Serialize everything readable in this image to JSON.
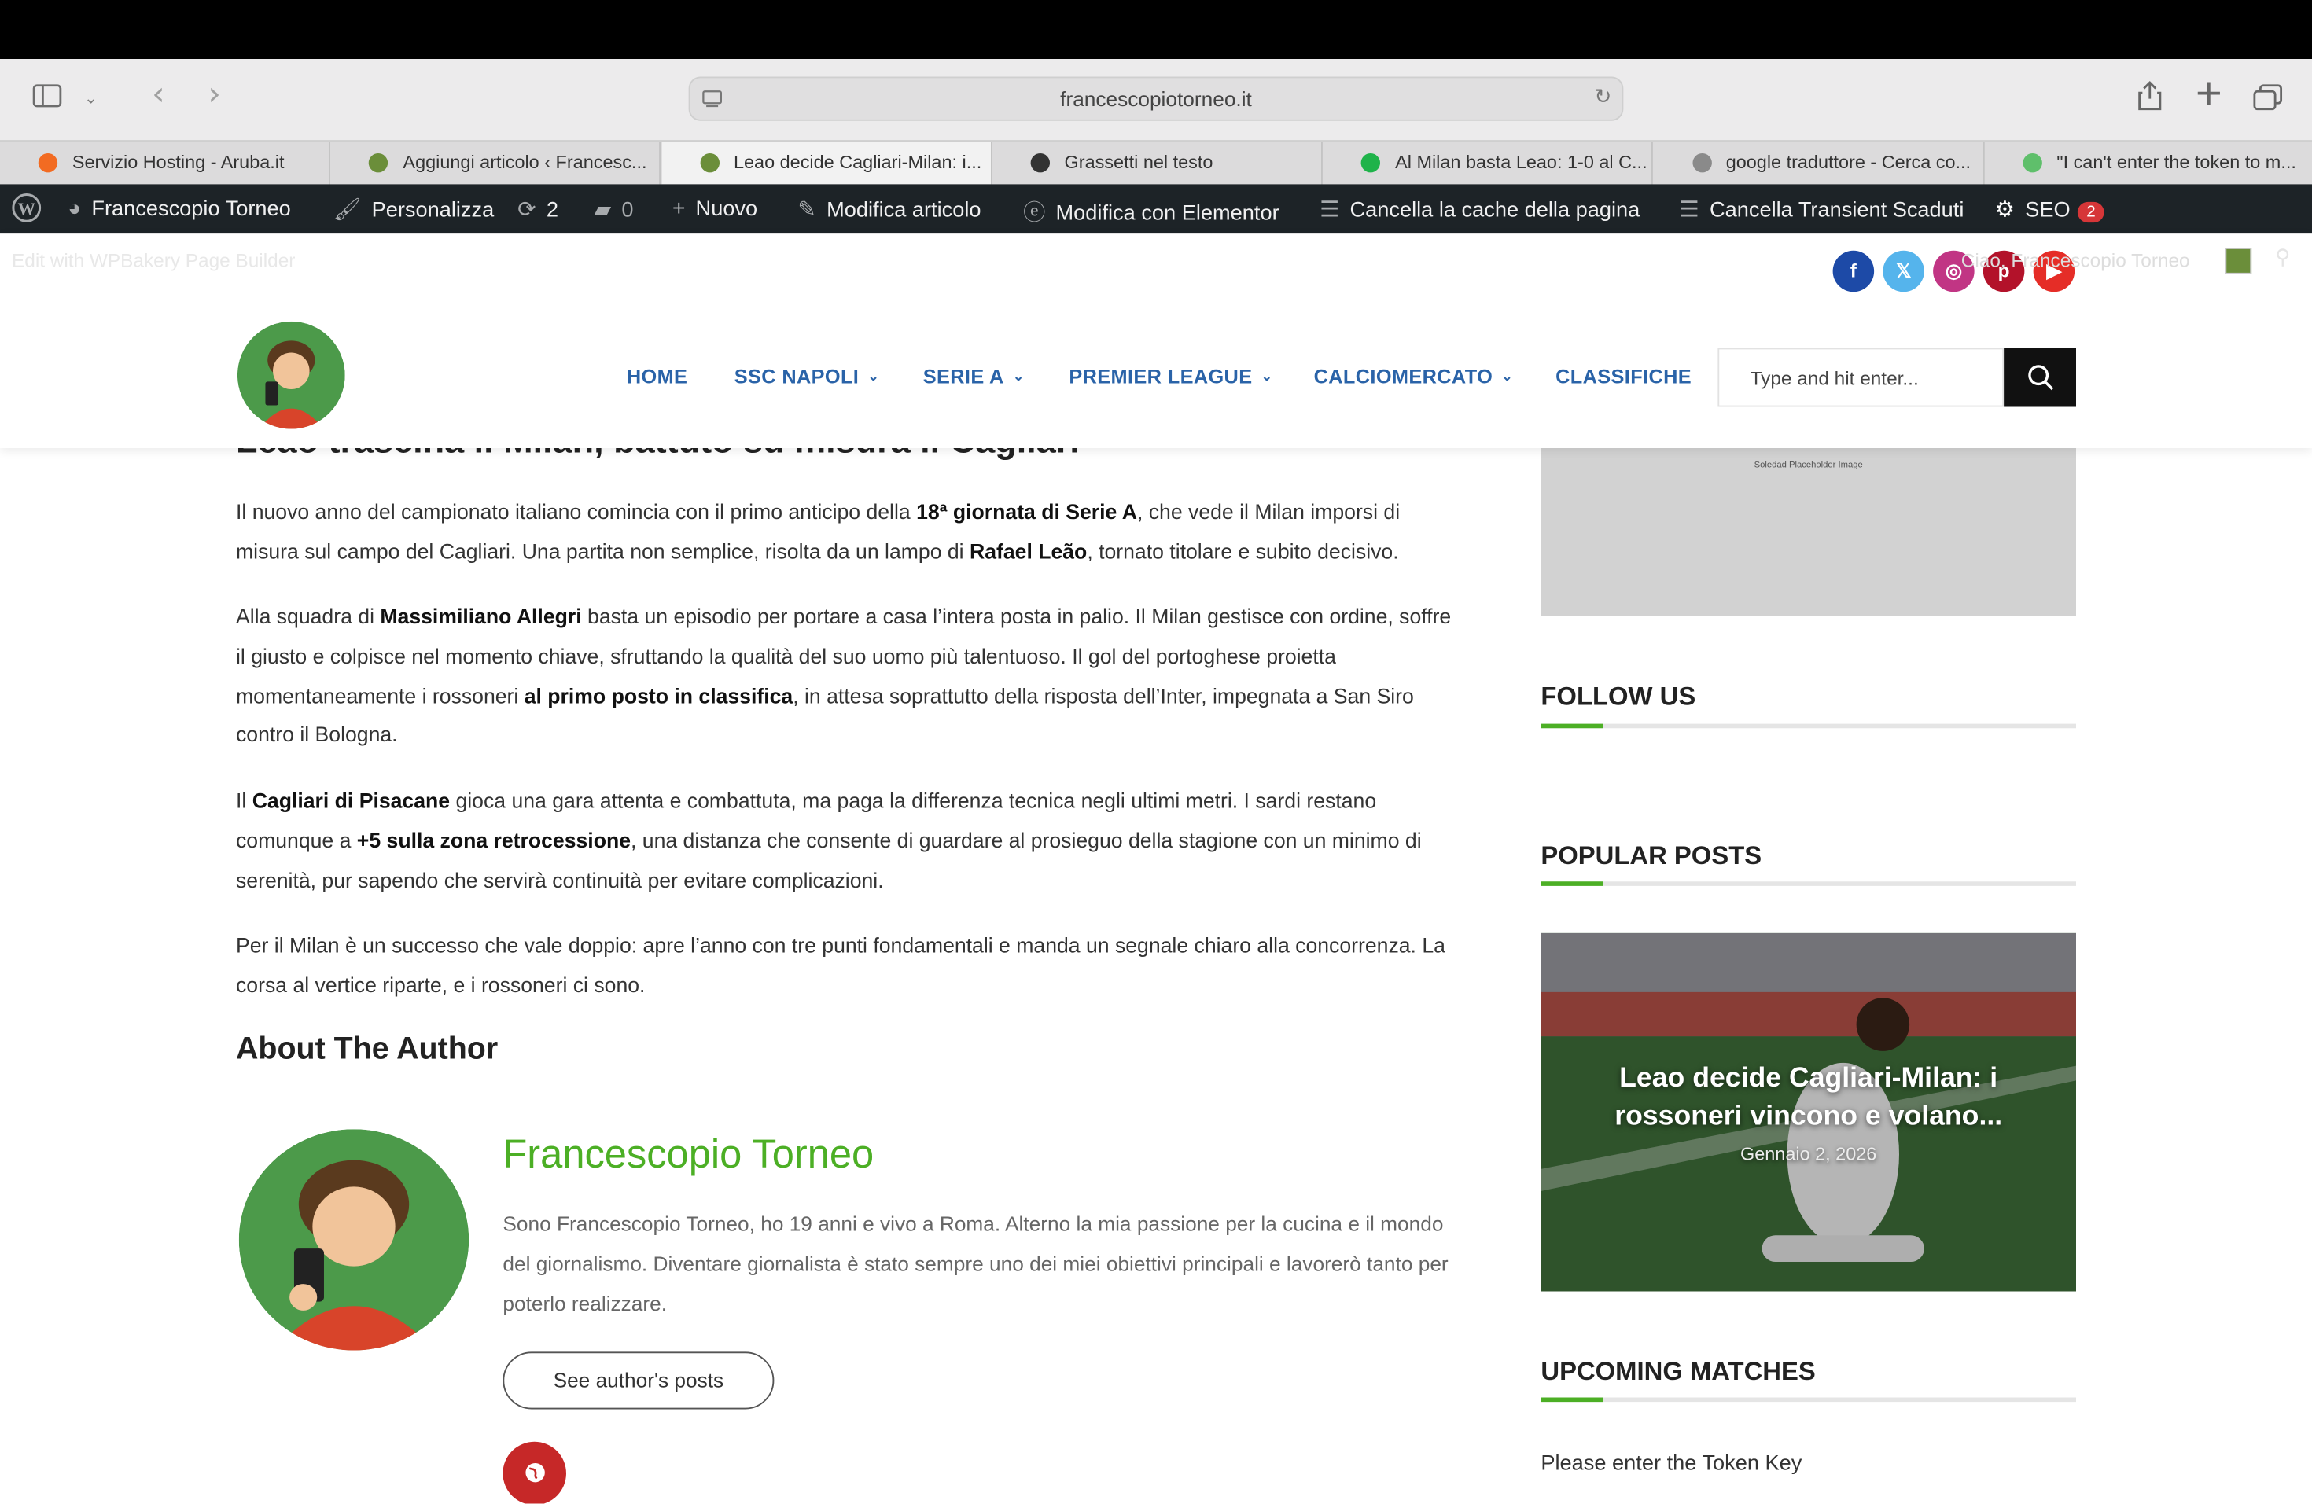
{
  "browser": {
    "url": "francescopiotorneo.it",
    "tabs": [
      {
        "label": "Servizio Hosting - Aruba.it",
        "favicon_color": "#f26b22"
      },
      {
        "label": "Aggiungi articolo ‹ Francesc...",
        "favicon_color": "#6b8e3a"
      },
      {
        "label": "Leao decide Cagliari-Milan: i...",
        "favicon_color": "#6b8e3a",
        "active": true
      },
      {
        "label": "Grassetti nel testo",
        "favicon_color": "#333333"
      },
      {
        "label": "Al Milan basta Leao: 1-0 al C...",
        "favicon_color": "#1fb34a"
      },
      {
        "label": "google traduttore - Cerca co...",
        "favicon_color": "#8a8a8a"
      },
      {
        "label": "\"I can't enter the token to m...",
        "favicon_color": "#5fbf6b"
      }
    ]
  },
  "adminbar": {
    "site_name": "Francescopio Torneo",
    "customize": "Personalizza",
    "updates": "2",
    "comments": "0",
    "new": "Nuovo",
    "edit_post": "Modifica articolo",
    "elementor": "Modifica con Elementor",
    "clear_cache": "Cancella la cache della pagina",
    "clear_transient": "Cancella Transient Scaduti",
    "seo": "SEO",
    "seo_count": "2",
    "wpbakery": "Edit with WPBakery Page Builder",
    "greeting": "Ciao, Francescopio Torneo"
  },
  "header": {
    "nav": [
      {
        "label": "HOME",
        "dropdown": false
      },
      {
        "label": "SSC NAPOLI",
        "dropdown": true
      },
      {
        "label": "SERIE A",
        "dropdown": true
      },
      {
        "label": "PREMIER LEAGUE",
        "dropdown": true
      },
      {
        "label": "CALCIOMERCATO",
        "dropdown": true
      },
      {
        "label": "CLASSIFICHE",
        "dropdown": false
      }
    ],
    "search_placeholder": "Type and hit enter...",
    "social": [
      {
        "name": "facebook-icon",
        "glyph": "f",
        "color": "#1d4aa7"
      },
      {
        "name": "x-icon",
        "glyph": "𝕏",
        "color": "#55b4ec"
      },
      {
        "name": "instagram-icon",
        "glyph": "◎",
        "color": "#c13584"
      },
      {
        "name": "pinterest-icon",
        "glyph": "p",
        "color": "#b3122a"
      },
      {
        "name": "youtube-icon",
        "glyph": "▶",
        "color": "#e52d27"
      }
    ]
  },
  "article": {
    "heading_partial": "Leao trascina il Milan, battuto su misura il Cagliari",
    "about_title": "About The Author",
    "author_name": "Francescopio Torneo",
    "author_bio": "Sono Francescopio Torneo, ho 19 anni e vivo a Roma. Alterno la mia passione per la cucina e il mondo del giornalismo. Diventare giornalista è stato sempre uno dei miei obiettivi principali e lavorerò tanto per poterlo realizzare.",
    "see_posts": "See author's posts"
  },
  "sidebar": {
    "placeholder_text": "Soledad Placeholder Image",
    "follow_us": "FOLLOW US",
    "popular_posts": "POPULAR POSTS",
    "popular_title": "Leao decide Cagliari-Milan: i rossoneri vincono e volano...",
    "popular_date": "Gennaio 2, 2026",
    "upcoming": "UPCOMING MATCHES",
    "token_msg": "Please enter the Token Key"
  },
  "colors": {
    "accent_green": "#4caf25",
    "nav_blue": "#2a63a8",
    "admin_bar": "#1d2327"
  }
}
